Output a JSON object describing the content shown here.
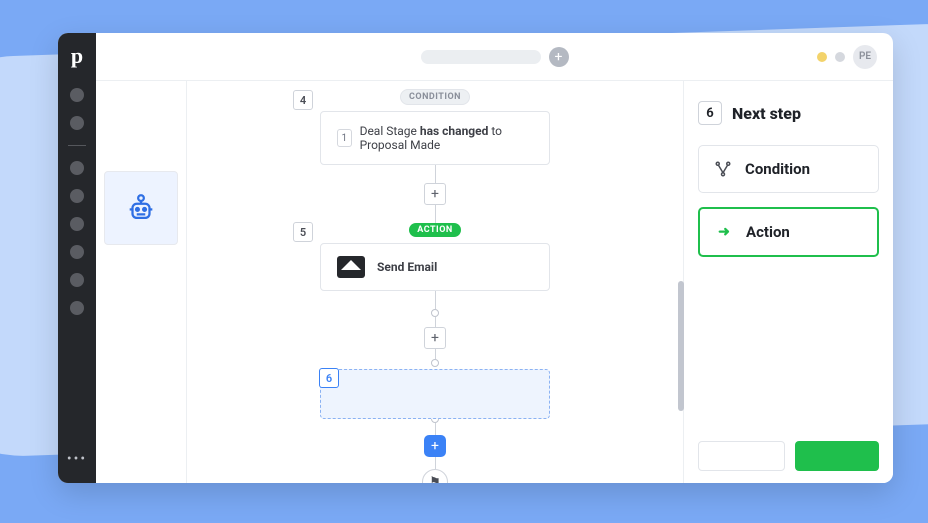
{
  "topbar": {
    "plus_glyph": "+",
    "avatar_initials": "PE"
  },
  "flow": {
    "step4": {
      "number": "4",
      "tag": "CONDITION",
      "rule_index": "1",
      "rule_field": "Deal Stage",
      "rule_middle": " has changed ",
      "rule_suffix": "to Proposal Made"
    },
    "step5": {
      "number": "5",
      "tag": "ACTION",
      "title": "Send Email"
    },
    "step6": {
      "number": "6"
    },
    "plus_glyph": "+",
    "end_glyph": "⚑"
  },
  "panel": {
    "step_number": "6",
    "heading": "Next step",
    "options": {
      "condition": "Condition",
      "action": "Action"
    },
    "action_arrow_glyph": "➜"
  }
}
